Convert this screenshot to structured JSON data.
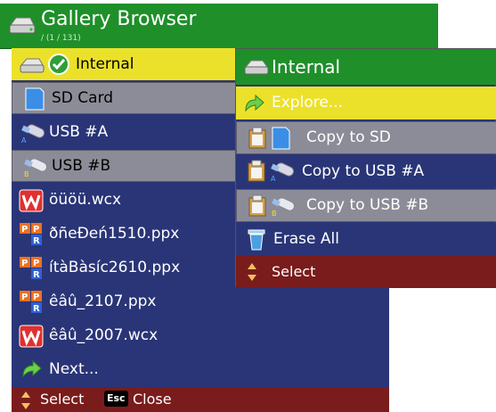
{
  "header": {
    "title": "Gallery Browser",
    "subtitle": "/ (1 / 131)"
  },
  "browser": {
    "items": [
      {
        "label": "Internal",
        "state": "selected"
      },
      {
        "label": "SD Card",
        "state": "highlighted"
      },
      {
        "label": "USB #A",
        "state": "normal"
      },
      {
        "label": "USB #B",
        "state": "highlighted"
      },
      {
        "label": "öüöü.wcx",
        "state": "normal"
      },
      {
        "label": "ðñeÐeń1510.ppx",
        "state": "normal"
      },
      {
        "label": "ítàBàsíc2610.ppx",
        "state": "normal"
      },
      {
        "label": "êâû_2107.ppx",
        "state": "normal"
      },
      {
        "label": "êâû_2007.wcx",
        "state": "normal"
      },
      {
        "label": "Next...",
        "state": "normal"
      }
    ],
    "status": {
      "select_label": "Select",
      "esc_key": "Esc",
      "close_label": "Close"
    }
  },
  "popup": {
    "title": "Internal",
    "items": [
      {
        "label": "Explore...",
        "state": "selected"
      },
      {
        "label": "Copy to SD",
        "state": "highlighted"
      },
      {
        "label": "Copy to USB #A",
        "state": "normal"
      },
      {
        "label": "Copy to USB #B",
        "state": "highlighted"
      },
      {
        "label": "Erase All",
        "state": "normal"
      }
    ],
    "status": {
      "select_label": "Select"
    }
  },
  "icons": {
    "drive": "drive-icon",
    "check": "check-icon",
    "sd_card": "sd-card-icon",
    "usb_a": "usb-a-icon",
    "usb_b": "usb-b-icon",
    "wcx_file": "wcx-file-icon",
    "ppx_file": "ppx-file-icon",
    "next_arrow": "next-arrow-icon",
    "clipboard": "clipboard-icon",
    "trash": "trash-icon",
    "updown": "updown-arrows-icon"
  },
  "colors": {
    "title_green": "#1f8f2a",
    "list_blue": "#2a3577",
    "selected_yellow": "#ece12a",
    "highlight_gray": "#8c8c98",
    "status_red": "#7a1c1c"
  }
}
